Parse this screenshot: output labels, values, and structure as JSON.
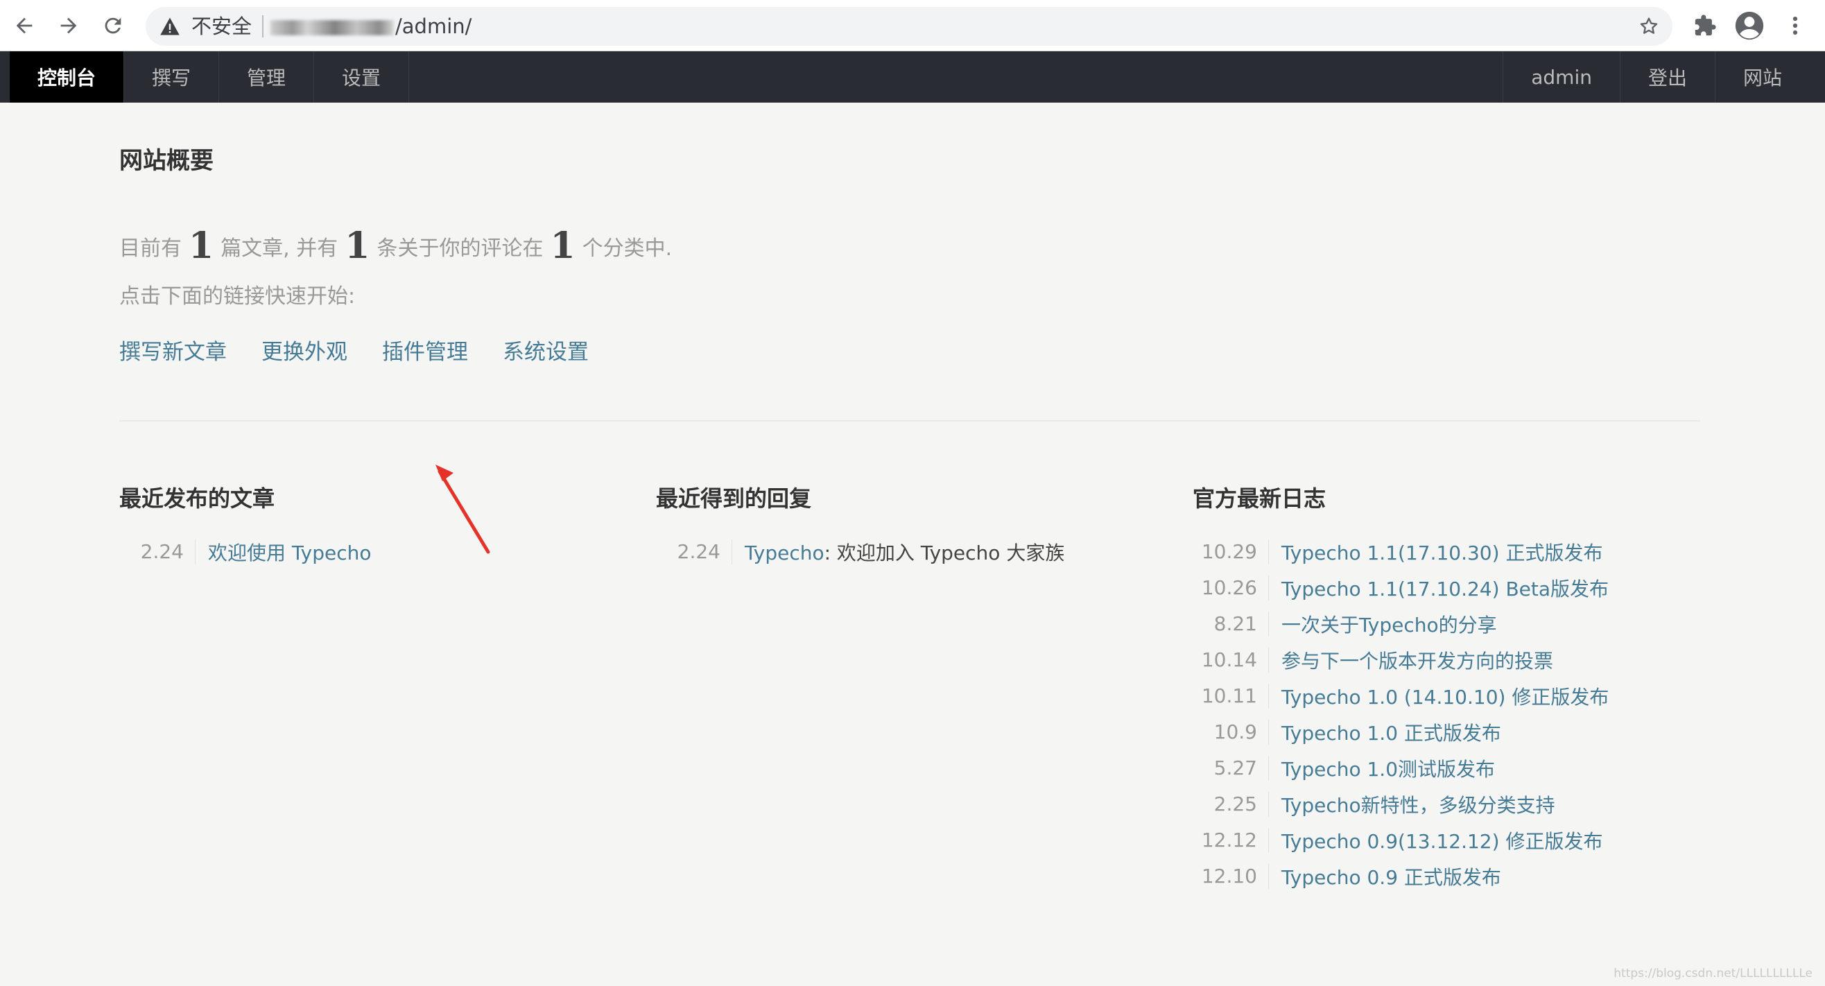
{
  "browser": {
    "security_label": "不安全",
    "url_path": "/admin/",
    "icons": [
      "back-icon",
      "forward-icon",
      "reload-icon",
      "warning-icon",
      "star-icon",
      "extensions-icon",
      "profile-icon",
      "more-icon"
    ]
  },
  "topnav": {
    "left": [
      {
        "label": "控制台",
        "active": true
      },
      {
        "label": "撰写"
      },
      {
        "label": "管理"
      },
      {
        "label": "设置"
      }
    ],
    "right": [
      {
        "label": "admin"
      },
      {
        "label": "登出"
      },
      {
        "label": "网站"
      }
    ]
  },
  "main": {
    "title": "网站概要",
    "summary": {
      "p1": "目前有",
      "posts": "1",
      "p2": "篇文章, 并有",
      "comments": "1",
      "p3": "条关于你的评论在",
      "categories": "1",
      "p4": "个分类中."
    },
    "quick_hint": "点击下面的链接快速开始:",
    "quick_links": [
      "撰写新文章",
      "更换外观",
      "插件管理",
      "系统设置"
    ]
  },
  "recent_posts": {
    "title": "最近发布的文章",
    "items": [
      {
        "date": "2.24",
        "title": "欢迎使用 Typecho"
      }
    ]
  },
  "recent_replies": {
    "title": "最近得到的回复",
    "items": [
      {
        "date": "2.24",
        "author": "Typecho",
        "text": ": 欢迎加入 Typecho 大家族"
      }
    ]
  },
  "official_log": {
    "title": "官方最新日志",
    "items": [
      {
        "date": "10.29",
        "title": "Typecho 1.1(17.10.30) 正式版发布"
      },
      {
        "date": "10.26",
        "title": "Typecho 1.1(17.10.24) Beta版发布"
      },
      {
        "date": "8.21",
        "title": "一次关于Typecho的分享"
      },
      {
        "date": "10.14",
        "title": "参与下一个版本开发方向的投票"
      },
      {
        "date": "10.11",
        "title": "Typecho 1.0 (14.10.10) 修正版发布"
      },
      {
        "date": "10.9",
        "title": "Typecho 1.0 正式版发布"
      },
      {
        "date": "5.27",
        "title": "Typecho 1.0测试版发布"
      },
      {
        "date": "2.25",
        "title": "Typecho新特性，多级分类支持"
      },
      {
        "date": "12.12",
        "title": "Typecho 0.9(13.12.12) 修正版发布"
      },
      {
        "date": "12.10",
        "title": "Typecho 0.9 正式版发布"
      }
    ]
  },
  "colors": {
    "link": "#467b96",
    "nav_bg": "#292d33",
    "page_bg": "#f5f5f4",
    "annotation": "#e5332a"
  },
  "watermark": "https://blog.csdn.net/LLLLLLLLLLe"
}
